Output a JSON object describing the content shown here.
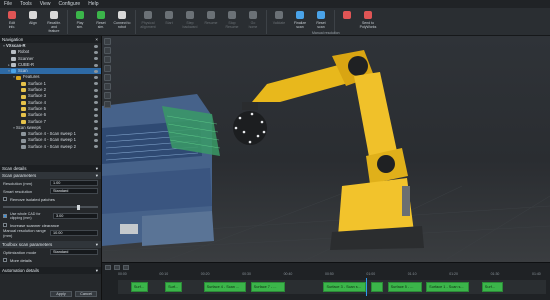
{
  "menu": [
    "File",
    "Tools",
    "View",
    "Configure",
    "Help"
  ],
  "toolbar": [
    {
      "icon": "edit-info-icon",
      "label": "Edit\ninfo.",
      "dis": false,
      "color": "#e05555"
    },
    {
      "icon": "align-icon",
      "label": "Align",
      "dis": false,
      "color": "#d9d9d9"
    },
    {
      "icon": "recalibrate-icon",
      "label": "Recalibr. and\nfeature",
      "dis": false,
      "color": "#d9d9d9"
    },
    {
      "icon": "play-sim-icon",
      "label": "Play\nsim.",
      "dis": false,
      "color": "#3bb54a"
    },
    {
      "icon": "reset-sim-icon",
      "label": "Reset\nsim.",
      "dis": false,
      "color": "#3bb54a"
    },
    {
      "icon": "connect-robot-icon",
      "label": "Connect to\nrobot",
      "dis": false,
      "color": "#d9d9d9"
    },
    {
      "icon": "physical-alignment-icon",
      "label": "Physical\nalignment",
      "dis": true,
      "color": "#6b7176"
    },
    {
      "icon": "start-icon",
      "label": "Start",
      "dis": true,
      "color": "#6b7176"
    },
    {
      "icon": "step-backward-icon",
      "label": "Step\nbackward",
      "dis": true,
      "color": "#6b7176"
    },
    {
      "icon": "resume-icon",
      "label": "Resume",
      "dis": true,
      "color": "#6b7176"
    },
    {
      "icon": "stop-resume-icon",
      "label": "Stop\nResume",
      "dis": true,
      "color": "#6b7176"
    },
    {
      "icon": "go-home-icon",
      "label": "Go\nhome",
      "dis": true,
      "color": "#6b7176"
    },
    {
      "icon": "validate-icon",
      "label": "Validate",
      "dis": true,
      "color": "#6b7176"
    },
    {
      "icon": "finalize-scan-icon",
      "label": "Finalize\nscan",
      "dis": false,
      "color": "#4aa3e8"
    },
    {
      "icon": "reset-scan-icon",
      "label": "Reset\nscan",
      "dis": false,
      "color": "#4aa3e8"
    },
    {
      "icon": "manual-resolution-icon",
      "label": "",
      "dis": false,
      "color": "#e05555"
    },
    {
      "icon": "polyworks-icon",
      "label": "Send to\nPolyWorks",
      "dis": false,
      "color": "#e05555"
    }
  ],
  "toolbar_group": "Manual resolution",
  "navigation": {
    "title": "Navigation",
    "items": [
      {
        "label": "VXscan-R",
        "level": 0,
        "twisty": "▾",
        "icon": "",
        "bold": true,
        "sel": false
      },
      {
        "label": "Robot",
        "level": 1,
        "twisty": "",
        "icon": "#b8bec4",
        "sel": false
      },
      {
        "label": "Scanner",
        "level": 1,
        "twisty": "",
        "icon": "#b8bec4",
        "sel": false
      },
      {
        "label": "CUBE-R",
        "level": 1,
        "twisty": "▸",
        "icon": "#b8bec4",
        "sel": false
      },
      {
        "label": "Scan",
        "level": 1,
        "twisty": "▾",
        "icon": "#4aa3e8",
        "sel": true
      },
      {
        "label": "Features",
        "level": 2,
        "twisty": "▾",
        "icon": "#d9a520",
        "sel": false
      },
      {
        "label": "Surface 1",
        "level": 3,
        "twisty": "",
        "icon": "#e6c24a",
        "sel": false
      },
      {
        "label": "Surface 2",
        "level": 3,
        "twisty": "",
        "icon": "#e6c24a",
        "sel": false
      },
      {
        "label": "Surface 3",
        "level": 3,
        "twisty": "",
        "icon": "#e6c24a",
        "sel": false
      },
      {
        "label": "Surface 4",
        "level": 3,
        "twisty": "",
        "icon": "#e6c24a",
        "sel": false
      },
      {
        "label": "Surface 5",
        "level": 3,
        "twisty": "",
        "icon": "#e6c24a",
        "sel": false
      },
      {
        "label": "Surface 6",
        "level": 3,
        "twisty": "",
        "icon": "#e6c24a",
        "sel": false
      },
      {
        "label": "Surface 7",
        "level": 3,
        "twisty": "",
        "icon": "#e6c24a",
        "sel": false
      },
      {
        "label": "Scan sweeps",
        "level": 2,
        "twisty": "▾",
        "icon": "",
        "sel": false
      },
      {
        "label": "Surface 4 - Scan sweep 1",
        "level": 3,
        "twisty": "",
        "icon": "#8e969c",
        "sel": false
      },
      {
        "label": "Surface 4 - Scan sweep 1",
        "level": 3,
        "twisty": "",
        "icon": "#8e969c",
        "sel": false
      },
      {
        "label": "Surface 4 - Scan sweep 2",
        "level": 3,
        "twisty": "",
        "icon": "#8e969c",
        "sel": false
      }
    ]
  },
  "scan_details": {
    "title": "Scan details",
    "params_title": "Scan parameters",
    "resolution_label": "Resolution (mm)",
    "resolution_value": "1.00",
    "smart_resolution_label": "Smart resolution",
    "smart_resolution_value": "Standard",
    "remove_patches_label": "Remove isolated patches",
    "use_cad_label": "Use whole CAD for clipping (mm)",
    "use_cad_value": "3.00",
    "increase_cam_label": "Increase scanner clearance",
    "manual_res_label": "Manual resolution range (mm)",
    "manual_res_value": "10.00",
    "toolbox_title": "Toolbox scan parameters",
    "optimization_label": "Optimization mode",
    "optimization_value": "Standard",
    "more_details": "More details",
    "automation_title": "Automation details",
    "apply": "Apply",
    "cancel": "Cancel"
  },
  "timeline": {
    "ticks": [
      "00:00",
      "00:10",
      "00:20",
      "00:30",
      "00:40",
      "00:50",
      "01:00",
      "01:10",
      "01:20",
      "01:30",
      "01:40"
    ],
    "segments": [
      {
        "label": "Surf...",
        "start": 0.03,
        "width": 0.04
      },
      {
        "label": "Surf...",
        "start": 0.11,
        "width": 0.04
      },
      {
        "label": "Surface 4 - Scan ...",
        "start": 0.2,
        "width": 0.1
      },
      {
        "label": "Surface 7 - ...",
        "start": 0.31,
        "width": 0.08
      },
      {
        "label": "Surface 3 - Scan s...",
        "start": 0.48,
        "width": 0.1
      },
      {
        "label": "",
        "start": 0.59,
        "width": 0.03
      },
      {
        "label": "Surface 5 - ...",
        "start": 0.63,
        "width": 0.08
      },
      {
        "label": "Surface 1 - Scan s...",
        "start": 0.72,
        "width": 0.1
      },
      {
        "label": "Surf...",
        "start": 0.85,
        "width": 0.05
      }
    ],
    "playhead": 0.58
  }
}
